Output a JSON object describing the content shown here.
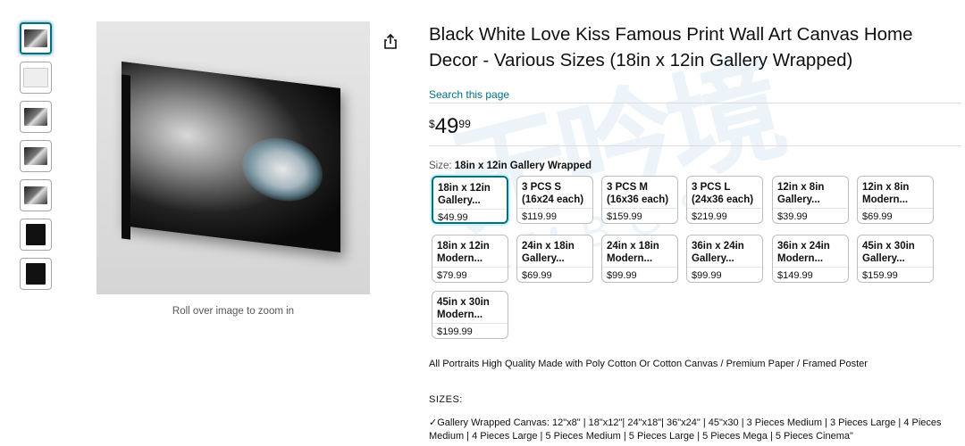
{
  "product": {
    "title": "Black White Love Kiss Famous Print Wall Art Canvas Home Decor - Various Sizes (18in x 12in Gallery Wrapped)",
    "search_link": "Search this page",
    "price": {
      "symbol": "$",
      "whole": "49",
      "fraction": "99"
    }
  },
  "gallery": {
    "zoom_hint": "Roll over image to zoom in",
    "thumbnails": [
      "canvas-kiss",
      "room-scene",
      "canvas-kiss-alt",
      "canvas-kiss-angle",
      "canvas-kiss-front",
      "canvas-edge-black",
      "canvas-side-view"
    ],
    "selected_index": 0
  },
  "size": {
    "label": "Size:",
    "selected": "18in x 12in Gallery Wrapped",
    "options": [
      {
        "name": "18in x 12in Gallery...",
        "price": "$49.99",
        "selected": true
      },
      {
        "name": "3 PCS S (16x24 each)",
        "price": "$119.99"
      },
      {
        "name": "3 PCS M (16x36 each)",
        "price": "$159.99"
      },
      {
        "name": "3 PCS L (24x36 each)",
        "price": "$219.99"
      },
      {
        "name": "12in x 8in Gallery...",
        "price": "$39.99"
      },
      {
        "name": "12in x 8in Modern...",
        "price": "$69.99"
      },
      {
        "name": "18in x 12in Modern...",
        "price": "$79.99"
      },
      {
        "name": "24in x 18in Gallery...",
        "price": "$69.99"
      },
      {
        "name": "24in x 18in Modern...",
        "price": "$99.99"
      },
      {
        "name": "36in x 24in Gallery...",
        "price": "$99.99"
      },
      {
        "name": "36in x 24in Modern...",
        "price": "$149.99"
      },
      {
        "name": "45in x 30in Gallery...",
        "price": "$159.99"
      },
      {
        "name": "45in x 30in Modern...",
        "price": "$199.99"
      }
    ]
  },
  "description": "All Portraits High Quality Made with Poly Cotton Or Cotton Canvas / Premium Paper / Framed Poster",
  "sizes_heading": "SIZES:",
  "sizes_text": "✓Gallery Wrapped Canvas: 12\"x8\" | 18\"x12\"| 24\"x18\"| 36\"x24\" | 45\"x30 | 3 Pieces Medium | 3 Pieces Large | 4 Pieces Medium | 4 Pieces Large | 5 Pieces Medium | 5 Pieces Large | 5 Pieces Mega | 5 Pieces Cinema\"",
  "colors": {
    "link": "#007185",
    "selected_border": "#007185"
  }
}
